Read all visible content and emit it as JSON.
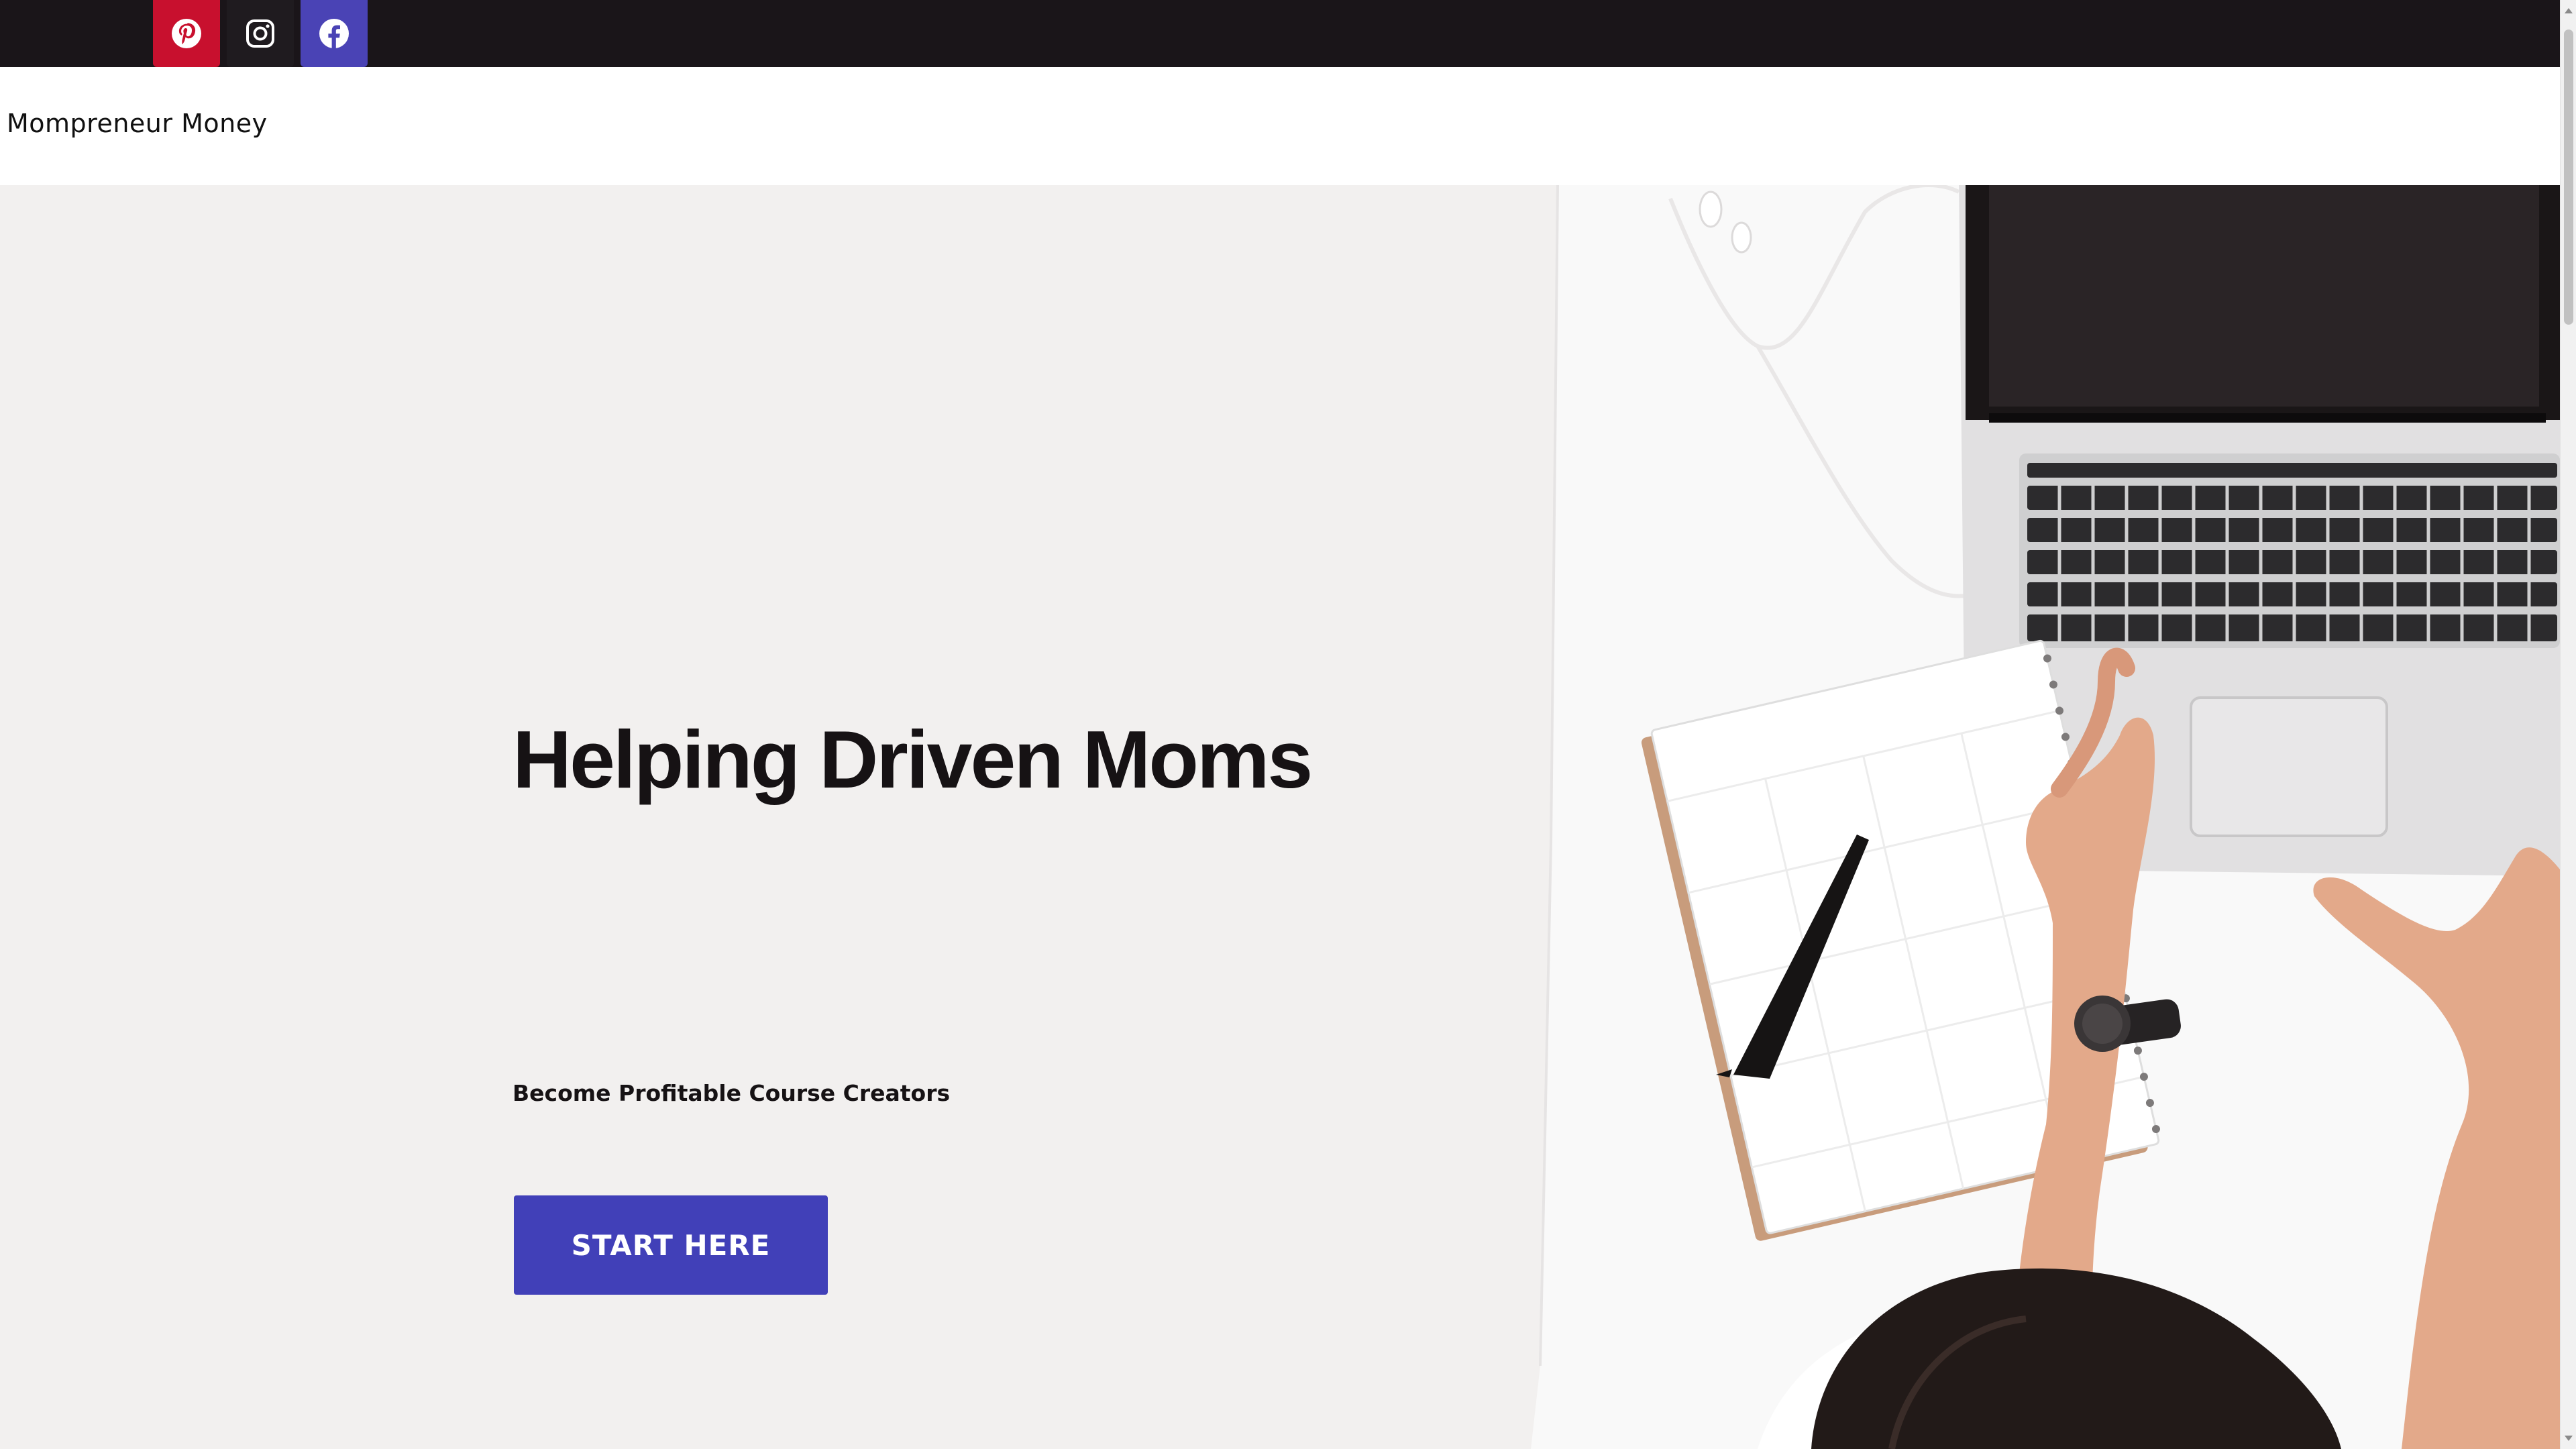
{
  "topbar": {
    "social_links": [
      {
        "icon": "pinterest-icon",
        "color": "#c8102e"
      },
      {
        "icon": "instagram-icon",
        "color": "#1f1b1f"
      },
      {
        "icon": "facebook-icon",
        "color": "#4a43b5"
      }
    ],
    "background": "#1a1519"
  },
  "header": {
    "site_title": "Mompreneur Money"
  },
  "hero": {
    "title": "Helping Driven Moms",
    "subtitle": "Become Profitable Course Creators",
    "cta_label": "START HERE",
    "accent_color": "#4140b8",
    "image": "desk-laptop-planner-photo"
  }
}
